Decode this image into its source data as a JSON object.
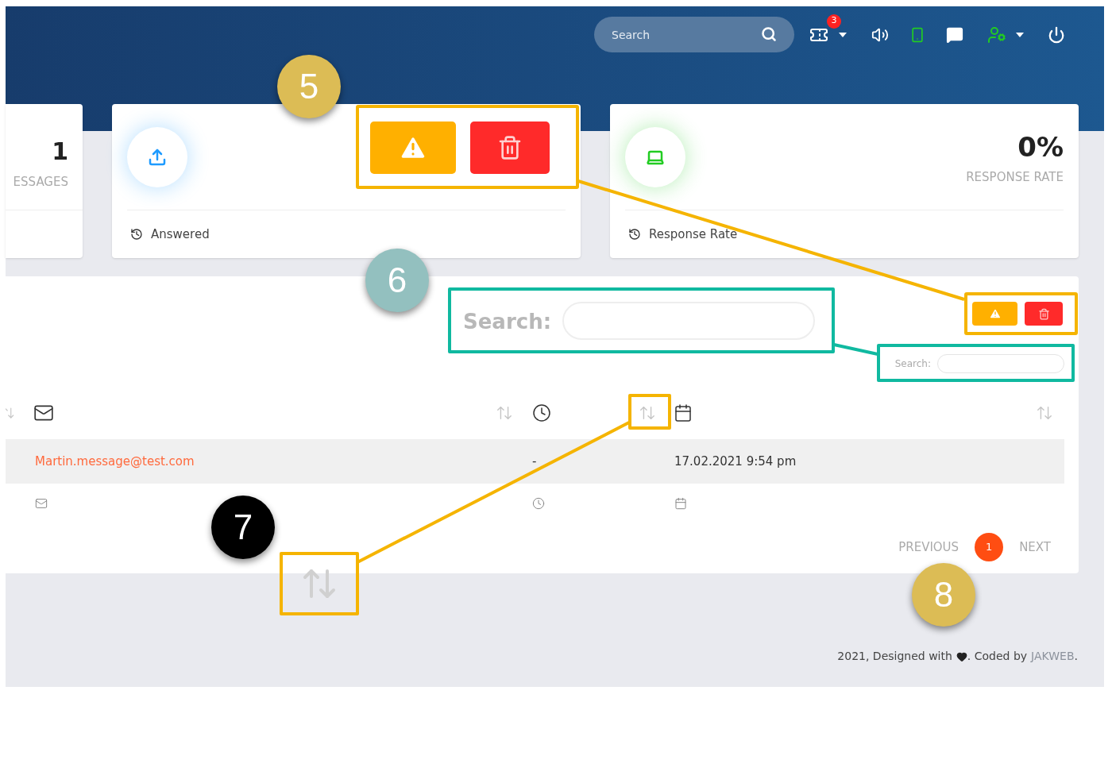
{
  "header": {
    "search": {
      "placeholder": "Search"
    },
    "notifications": {
      "count": "3"
    }
  },
  "stat_cards": [
    {
      "kind": "partial",
      "value": "1",
      "label": "ESSAGES"
    },
    {
      "kind": "actions",
      "footer": "Answered",
      "color": "#1e9bff"
    },
    {
      "kind": "stat",
      "value": "0%",
      "label": "RESPONSE RATE",
      "footer": "Response Rate",
      "color": "#22cc22"
    }
  ],
  "table": {
    "search_label": "Search:",
    "rows": [
      {
        "email": "Martin.message@test.com",
        "time": "-",
        "date": "17.02.2021 9:54 pm"
      }
    ],
    "pagination": {
      "previous": "PREVIOUS",
      "pages": [
        {
          "label": "1",
          "selected": true
        }
      ],
      "next": "NEXT"
    }
  },
  "footer": {
    "text": "2021, Designed with",
    "coded_by": ". Coded by",
    "author": "JAKWEB",
    "end": "."
  },
  "annotations": {
    "markers": [
      {
        "label": "5",
        "color": "#dcbc55"
      },
      {
        "label": "6",
        "color": "#93c0bf"
      },
      {
        "label": "7",
        "color": "#000000"
      },
      {
        "label": "8",
        "color": "#dcbc55"
      }
    ],
    "zoom_search_label": "Search:"
  }
}
